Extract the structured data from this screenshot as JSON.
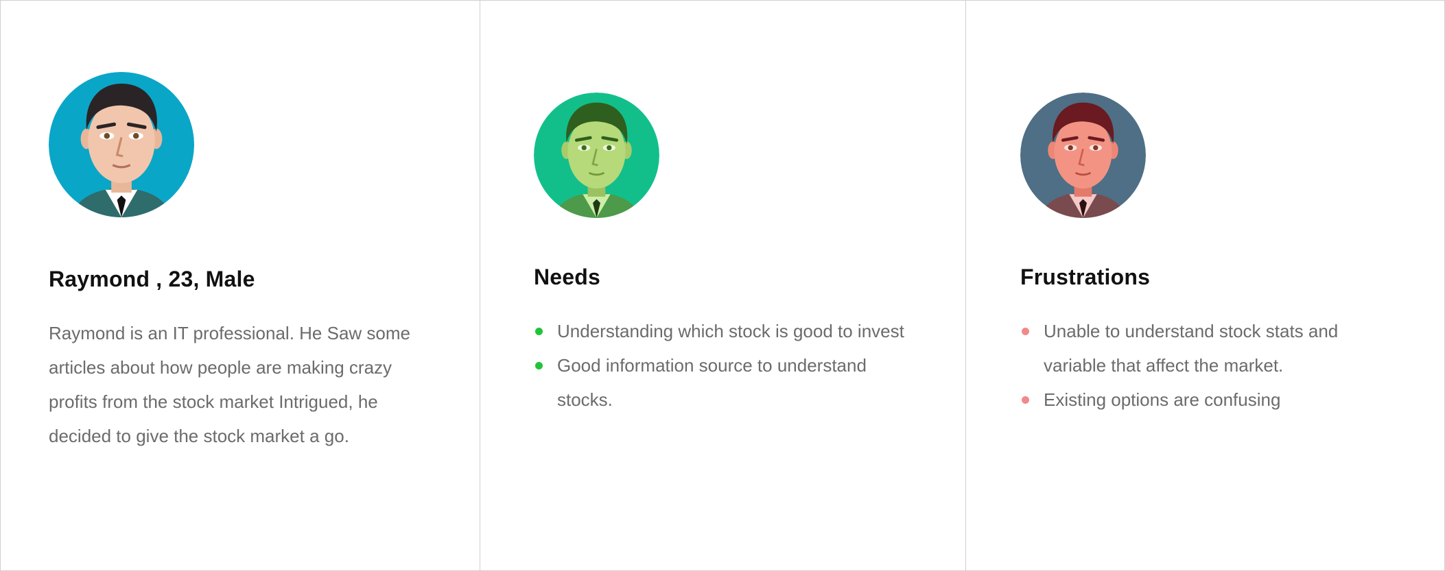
{
  "persona": {
    "title": "Raymond , 23, Male",
    "bio": "Raymond is an IT professional. He Saw some articles about how people are making crazy profits from the stock market Intrigued, he decided to give the stock market a go."
  },
  "needs": {
    "title": "Needs",
    "items": [
      "Understanding which stock is good to invest",
      "Good information source to understand stocks."
    ]
  },
  "frustrations": {
    "title": "Frustrations",
    "items": [
      "Unable to understand stock stats and variable that affect the market.",
      "Existing options are confusing"
    ]
  },
  "colors": {
    "persona_avatar_bg": "#0aa6c8",
    "needs_avatar_bg": "#12bf8a",
    "frustrations_avatar_bg": "#4e6f85",
    "needs_bullet": "#22c33a",
    "frustrations_bullet": "#f08a8a"
  },
  "icons": {
    "persona_avatar": "man-avatar-icon",
    "needs_avatar": "man-avatar-green-icon",
    "frustrations_avatar": "man-avatar-red-icon"
  }
}
